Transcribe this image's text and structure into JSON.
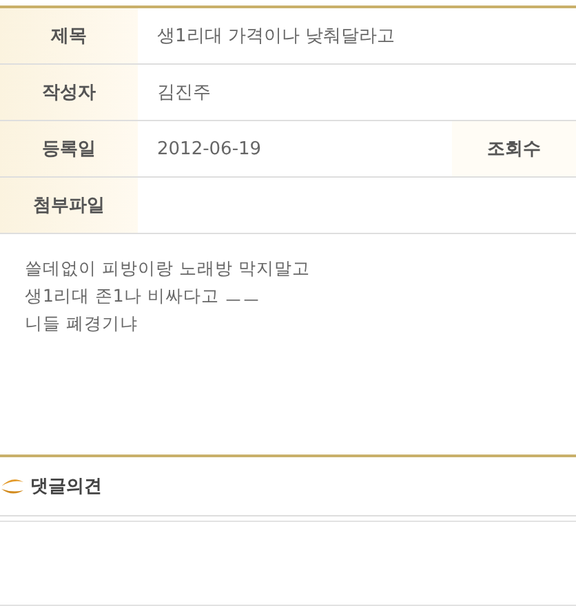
{
  "post_fields": [
    {
      "label": "제목",
      "value": "생1리대 가격이나 낮춰달라고"
    },
    {
      "label": "작성자",
      "value": "김진주"
    },
    {
      "label": "등록일",
      "value": "2012-06-19",
      "extra_label": "조회수"
    },
    {
      "label": "첨부파일"
    }
  ],
  "body_lines": [
    "쓸데없이 피방이랑 노래방 막지말고",
    "생1리대 존1나 비싸다고 ㅡㅡ",
    "니들 폐경기냐"
  ],
  "comments": {
    "title": "댓글의견"
  }
}
